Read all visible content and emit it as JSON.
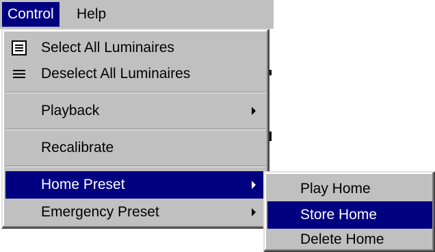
{
  "menubar": {
    "items": [
      {
        "label": "Control"
      },
      {
        "label": "Help"
      }
    ]
  },
  "control_menu": {
    "items": [
      {
        "label": "Select All Luminaires",
        "icon": "select-all-icon"
      },
      {
        "label": "Deselect All Luminaires",
        "icon": "deselect-all-icon"
      },
      {
        "label": "Playback",
        "submenu": true
      },
      {
        "label": "Recalibrate"
      },
      {
        "label": "Home Preset",
        "submenu": true,
        "selected": true
      },
      {
        "label": "Emergency Preset",
        "submenu": true
      }
    ]
  },
  "home_preset_submenu": {
    "items": [
      {
        "label": "Play Home"
      },
      {
        "label": "Store Home",
        "selected": true
      },
      {
        "label": "Delete Home"
      }
    ]
  },
  "colors": {
    "menu_face": "#c0c0c0",
    "highlight": "#000080",
    "highlight_text": "#ffffff"
  }
}
